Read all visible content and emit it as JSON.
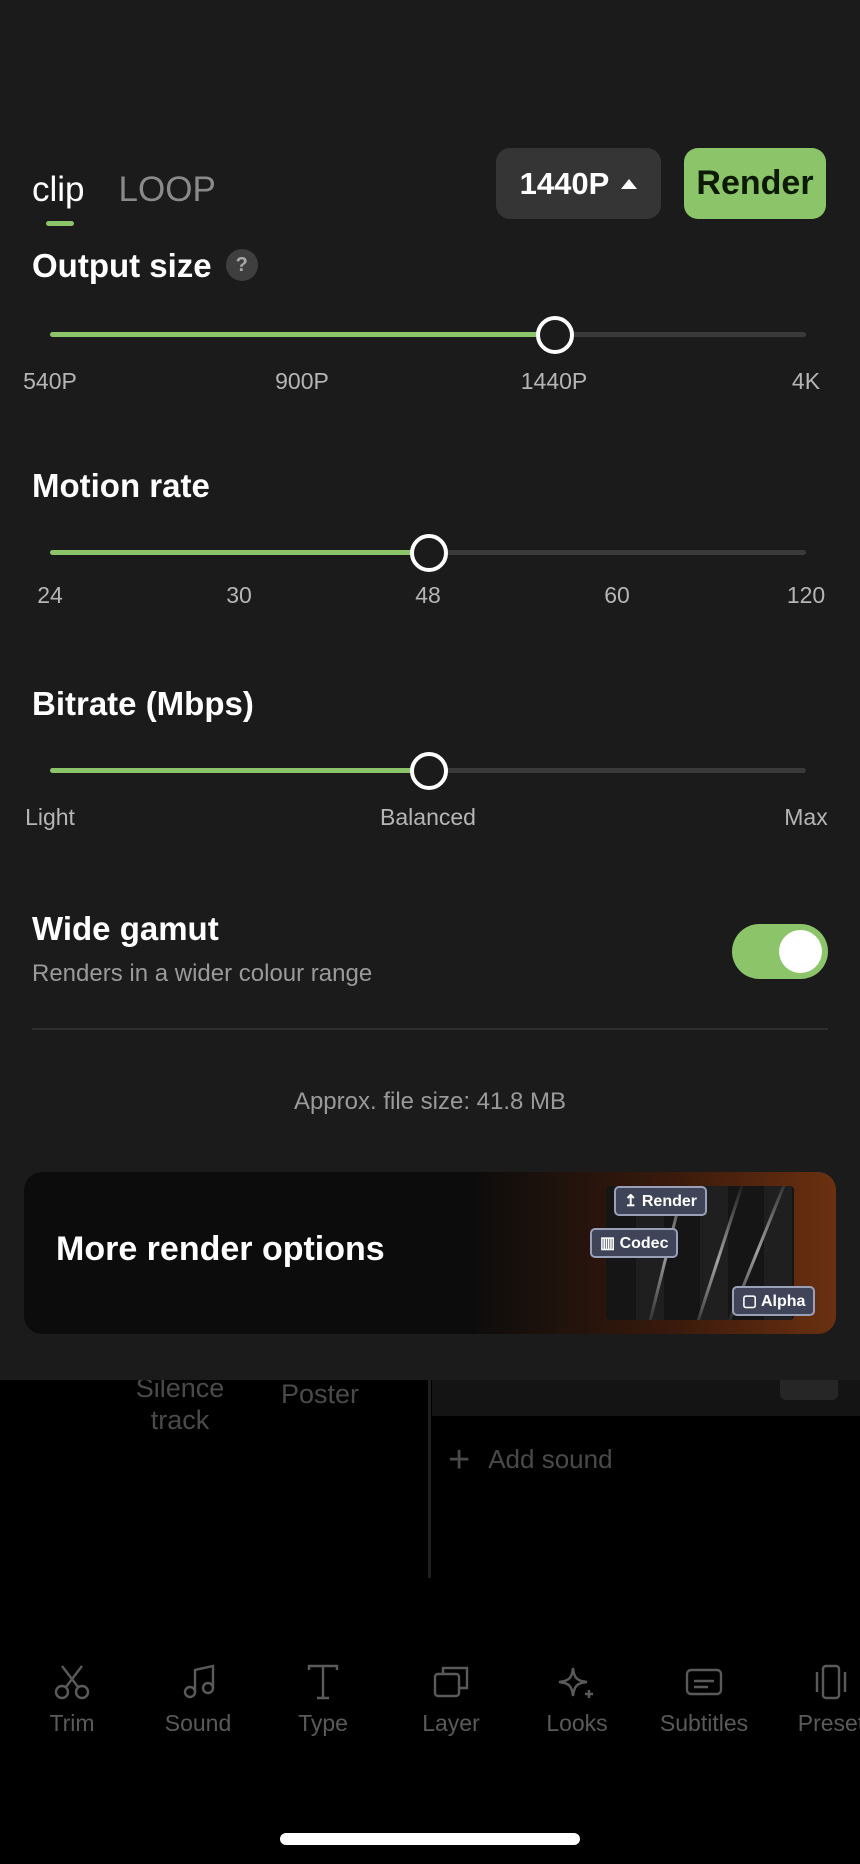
{
  "tabs": [
    {
      "label": "clip",
      "active": true
    },
    {
      "label": "LOOP",
      "active": false
    }
  ],
  "header": {
    "resolution_label": "1440P",
    "render_label": "Render"
  },
  "output_size": {
    "title": "Output size",
    "help_icon_label": "?",
    "ticks": [
      "540P",
      "900P",
      "1440P",
      "4K"
    ],
    "selected_index": 2
  },
  "motion_rate": {
    "title": "Motion rate",
    "ticks": [
      "24",
      "30",
      "48",
      "60",
      "120"
    ],
    "selected_index": 2
  },
  "bitrate": {
    "title": "Bitrate (Mbps)",
    "ticks": [
      "Light",
      "Balanced",
      "Max"
    ],
    "selected_index": 1
  },
  "wide_gamut": {
    "title": "Wide gamut",
    "subtitle": "Renders in a wider colour range",
    "enabled": true
  },
  "file_size_text": "Approx. file size: 41.8 MB",
  "promo": {
    "title": "More render options",
    "chips": {
      "render": "Render",
      "codec": "Codec",
      "alpha": "Alpha"
    }
  },
  "background": {
    "tiles": {
      "silence": "Silence\ntrack",
      "poster": "Poster"
    },
    "add_sound": "Add sound",
    "nav": [
      {
        "label": "Trim",
        "icon": "scissors-icon"
      },
      {
        "label": "Sound",
        "icon": "music-note-icon"
      },
      {
        "label": "Type",
        "icon": "text-icon"
      },
      {
        "label": "Layer",
        "icon": "layers-icon"
      },
      {
        "label": "Looks",
        "icon": "sparkle-icon"
      },
      {
        "label": "Subtitles",
        "icon": "subtitles-icon"
      },
      {
        "label": "Preset",
        "icon": "preset-icon"
      }
    ]
  },
  "colors": {
    "accent": "#8cc46a",
    "sheet": "#1b1b1b",
    "background": "#000000"
  }
}
